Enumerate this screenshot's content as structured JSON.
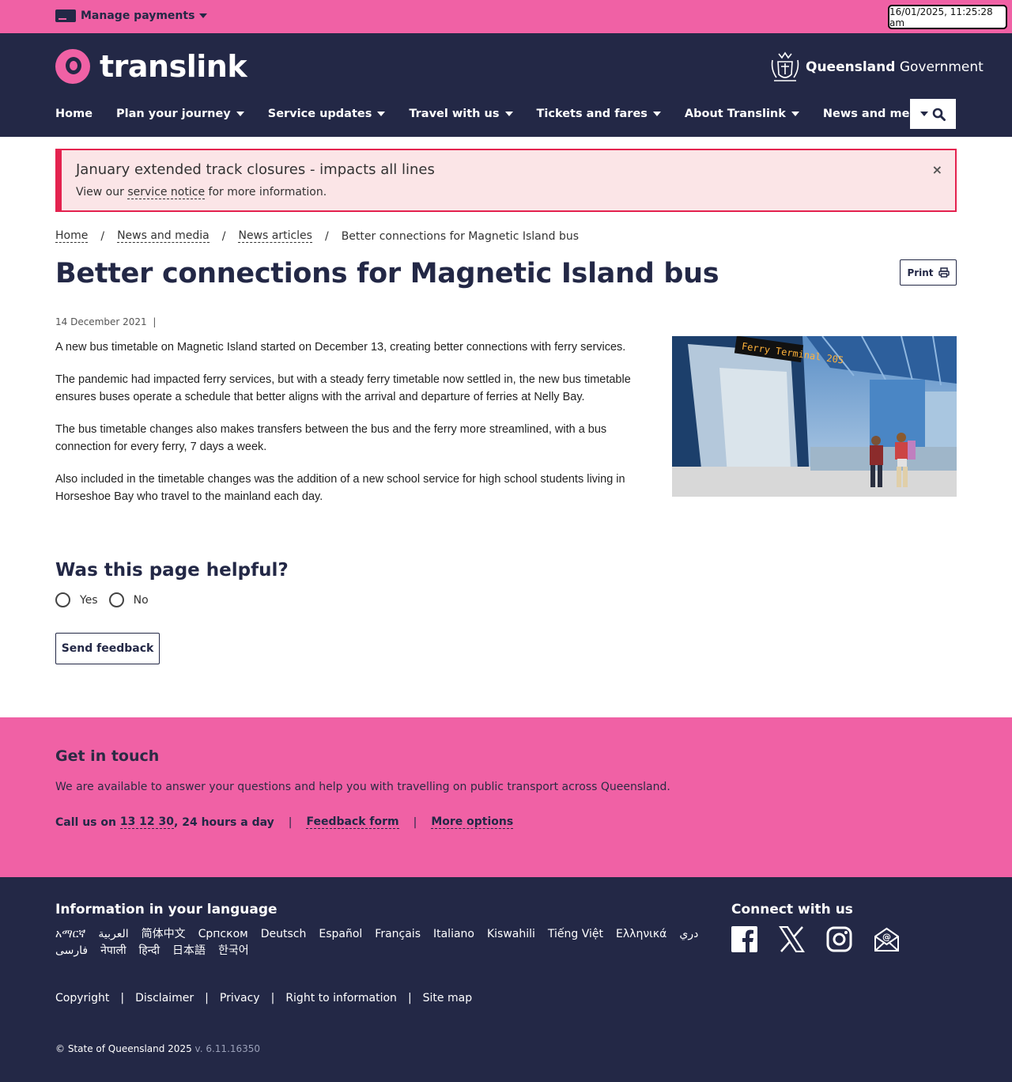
{
  "topbar": {
    "manage_payments": "Manage payments",
    "datetime": "16/01/2025, 11:25:28 am"
  },
  "header": {
    "logo_text": "translink",
    "qgov_bold": "Queensland",
    "qgov_rest": "Government",
    "nav": [
      {
        "label": "Home",
        "has_dropdown": false
      },
      {
        "label": "Plan your journey",
        "has_dropdown": true
      },
      {
        "label": "Service updates",
        "has_dropdown": true
      },
      {
        "label": "Travel with us",
        "has_dropdown": true
      },
      {
        "label": "Tickets and fares",
        "has_dropdown": true
      },
      {
        "label": "About Translink",
        "has_dropdown": true
      },
      {
        "label": "News and media",
        "has_dropdown": true
      }
    ]
  },
  "alert": {
    "title": "January extended track closures - impacts all lines",
    "text_before": "View our ",
    "link": "service notice",
    "text_after": " for more information.",
    "close": "×"
  },
  "breadcrumb": {
    "items": [
      "Home",
      "News and media",
      "News articles"
    ],
    "current": "Better connections for Magnetic Island bus",
    "separator": "/"
  },
  "article": {
    "title": "Better connections for Magnetic Island bus",
    "print_label": "Print",
    "date": "14 December 2021",
    "date_separator": "|",
    "paragraphs": [
      "A new bus timetable on Magnetic Island started on December 13, creating better connections with ferry services.",
      "The pandemic had impacted ferry services, but with a steady ferry timetable now settled in, the new bus timetable ensures buses operate a schedule that better aligns with the arrival and departure of ferries at Nelly Bay.",
      "The bus timetable changes also makes transfers between the bus and the ferry more streamlined, with a bus connection for every ferry, 7 days a week.",
      "Also included in the timetable changes was the addition of a new school service for high school students living in Horseshoe Bay who travel to the mainland each day."
    ],
    "image_sign_text": "Ferry Terminal 205"
  },
  "feedback": {
    "question": "Was this page helpful?",
    "yes": "Yes",
    "no": "No",
    "send": "Send feedback"
  },
  "touch": {
    "title": "Get in touch",
    "text": "We are available to answer your questions and help you with travelling on public transport across Queensland.",
    "call_prefix": "Call us on ",
    "phone": "13 12 30",
    "call_suffix": ", 24 hours a day",
    "feedback_form": "Feedback form",
    "more_options": "More options",
    "separator": "|"
  },
  "footer": {
    "lang_title": "Information in your language",
    "languages": [
      "አማርኛ",
      "العربية",
      "简体中文",
      "Српском",
      "Deutsch",
      "Español",
      "Français",
      "Italiano",
      "Kiswahili",
      "Tiếng Việt",
      "Ελληνικά",
      "دري",
      "فارسی",
      "नेपाली",
      "हिन्दी",
      "日本語",
      "한국어"
    ],
    "connect_title": "Connect with us",
    "socials": [
      "facebook-icon",
      "x-icon",
      "instagram-icon",
      "email-icon"
    ],
    "links": [
      "Copyright",
      "Disclaimer",
      "Privacy",
      "Right to information",
      "Site map"
    ],
    "separator": "|",
    "copyright": "© State of Queensland 2025",
    "version": "v. 6.11.16350"
  },
  "colors": {
    "pink": "#f061a5",
    "navy": "#232846",
    "alert_red": "#e4224f",
    "alert_bg": "#fbe5e7"
  }
}
